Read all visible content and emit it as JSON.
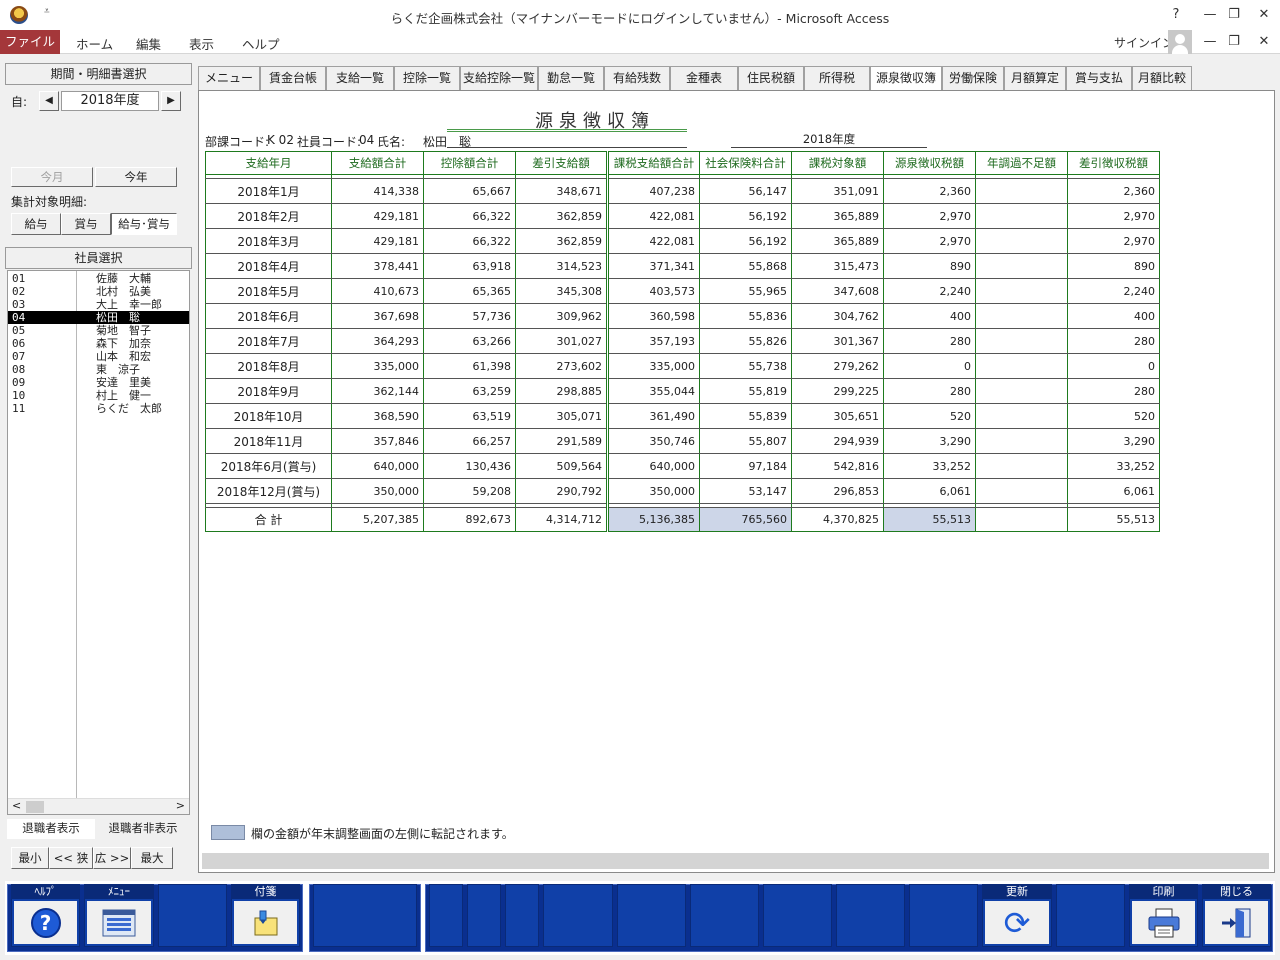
{
  "window": {
    "title": "らくだ企画株式会社（マイナンバーモードにログインしていません）- Microsoft Access",
    "qat_glyph": "⩡",
    "controls": {
      "help": "?",
      "minimize": "—",
      "restore": "❐",
      "close": "✕"
    }
  },
  "ribbon": {
    "file": "ファイル",
    "tabs": [
      "ホーム",
      "編集",
      "表示",
      "ヘルプ"
    ],
    "signin": "サインイン",
    "minimize_glyph": "—",
    "restore_glyph": "❐",
    "close_glyph": "✕"
  },
  "left": {
    "period_header": "期間・明細書選択",
    "from_label": "自:",
    "year_value": "2018年度",
    "prev_glyph": "◀",
    "next_glyph": "▶",
    "this_month": "今月",
    "this_year": "今年",
    "target_label": "集計対象明細:",
    "target_options": [
      "給与",
      "賞与",
      "給与･賞与"
    ],
    "employee_header": "社員選択",
    "employees": [
      {
        "code": "01",
        "name": "佐藤　大輔"
      },
      {
        "code": "02",
        "name": "北村　弘美"
      },
      {
        "code": "03",
        "name": "大上　幸一郎"
      },
      {
        "code": "04",
        "name": "松田　聡"
      },
      {
        "code": "05",
        "name": "菊地　智子"
      },
      {
        "code": "06",
        "name": "森下　加奈"
      },
      {
        "code": "07",
        "name": "山本　和宏"
      },
      {
        "code": "08",
        "name": "東　涼子"
      },
      {
        "code": "09",
        "name": "安達　里美"
      },
      {
        "code": "10",
        "name": "村上　健一"
      },
      {
        "code": "11",
        "name": "らくだ　太郎"
      }
    ],
    "scroll_left": "<",
    "scroll_right": ">",
    "show_retired": "退職者表示",
    "hide_retired": "退職者非表示",
    "zoom_buttons": [
      "最小",
      "<< 狭",
      "広 >>",
      "最大"
    ]
  },
  "tabs": [
    "メニュー",
    "賃金台帳",
    "支給一覧",
    "控除一覧",
    "支給控除一覧",
    "勤怠一覧",
    "有給残数",
    "金種表",
    "住民税額",
    "所得税",
    "源泉徴収簿",
    "労働保険",
    "月額算定",
    "賞与支払",
    "月額比較"
  ],
  "active_tab": "源泉徴収簿",
  "report": {
    "title": "源泉徴収簿",
    "dept_label": "部課コード:",
    "dept_code": "K 02",
    "emp_label": "社員コード:",
    "emp_code": "04",
    "name_label": "氏名:",
    "name": "松田　聡",
    "year": "2018年度",
    "columns": [
      "支給年月",
      "支給額合計",
      "控除額合計",
      "差引支給額",
      "課税支給額合計",
      "社会保険料合計",
      "課税対象額",
      "源泉徴収税額",
      "年調過不足額",
      "差引徴収税額"
    ],
    "rows": [
      [
        "2018年1月",
        "414,338",
        "65,667",
        "348,671",
        "407,238",
        "56,147",
        "351,091",
        "2,360",
        "",
        "2,360"
      ],
      [
        "2018年2月",
        "429,181",
        "66,322",
        "362,859",
        "422,081",
        "56,192",
        "365,889",
        "2,970",
        "",
        "2,970"
      ],
      [
        "2018年3月",
        "429,181",
        "66,322",
        "362,859",
        "422,081",
        "56,192",
        "365,889",
        "2,970",
        "",
        "2,970"
      ],
      [
        "2018年4月",
        "378,441",
        "63,918",
        "314,523",
        "371,341",
        "55,868",
        "315,473",
        "890",
        "",
        "890"
      ],
      [
        "2018年5月",
        "410,673",
        "65,365",
        "345,308",
        "403,573",
        "55,965",
        "347,608",
        "2,240",
        "",
        "2,240"
      ],
      [
        "2018年6月",
        "367,698",
        "57,736",
        "309,962",
        "360,598",
        "55,836",
        "304,762",
        "400",
        "",
        "400"
      ],
      [
        "2018年7月",
        "364,293",
        "63,266",
        "301,027",
        "357,193",
        "55,826",
        "301,367",
        "280",
        "",
        "280"
      ],
      [
        "2018年8月",
        "335,000",
        "61,398",
        "273,602",
        "335,000",
        "55,738",
        "279,262",
        "0",
        "",
        "0"
      ],
      [
        "2018年9月",
        "362,144",
        "63,259",
        "298,885",
        "355,044",
        "55,819",
        "299,225",
        "280",
        "",
        "280"
      ],
      [
        "2018年10月",
        "368,590",
        "63,519",
        "305,071",
        "361,490",
        "55,839",
        "305,651",
        "520",
        "",
        "520"
      ],
      [
        "2018年11月",
        "357,846",
        "66,257",
        "291,589",
        "350,746",
        "55,807",
        "294,939",
        "3,290",
        "",
        "3,290"
      ],
      [
        "2018年6月(賞与)",
        "640,000",
        "130,436",
        "509,564",
        "640,000",
        "97,184",
        "542,816",
        "33,252",
        "",
        "33,252"
      ],
      [
        "2018年12月(賞与)",
        "350,000",
        "59,208",
        "290,792",
        "350,000",
        "53,147",
        "296,853",
        "6,061",
        "",
        "6,061"
      ]
    ],
    "total": [
      "合 計",
      "5,207,385",
      "892,673",
      "4,314,712",
      "5,136,385",
      "765,560",
      "4,370,825",
      "55,513",
      "",
      "55,513"
    ],
    "highlight_color": "#cdd6e8",
    "legend": "欄の金額が年末調整画面の左側に転記されます。"
  },
  "toolbar": {
    "help": "ﾍﾙﾌﾟ",
    "menu": "ﾒﾆｭｰ",
    "sticky": "付箋",
    "refresh": "更新",
    "print": "印刷",
    "close": "閉じる",
    "help_glyph": "?",
    "refresh_glyph": "⟳"
  },
  "colors": {
    "file_tab": "#a4373a",
    "toolbar_blue": "#1040a8",
    "grid_green": "#1e7a1e"
  }
}
